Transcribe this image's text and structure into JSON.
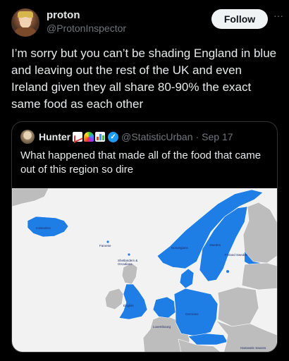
{
  "post": {
    "display_name": "proton",
    "handle": "@ProtonInspector",
    "follow_label": "Follow",
    "more_label": "···",
    "text": "I’m sorry but you can’t be shading England in blue and leaving out the rest of the UK and even Ireland given they all share 80-90% the exact same food as each other"
  },
  "quote": {
    "display_name": "Hunter",
    "badges": [
      "chart-increasing-emoji",
      "rainbow-emoji",
      "bar-chart-emoji"
    ],
    "handle": "@StatisticUrban",
    "separator": "·",
    "date": "Sep 17",
    "text": "What happened that made all of the food that came out of this region so dire",
    "map": {
      "labels": {
        "iceland": "Icelanders",
        "faroe": "Faroese",
        "shetland": "Shetlanders & Orcadians",
        "norway": "Norwegians",
        "sweden": "Swedes",
        "finland": "Finland Swedes",
        "england": "English",
        "germany": "Germans",
        "luxembourg": "Luxembourg",
        "hamburg": "Hanseatic Saxons"
      },
      "colors": {
        "highlight": "#1f7de6",
        "land": "#bdbdbd",
        "sea": "#f2f2f2",
        "border": "#ffffff"
      }
    }
  },
  "theme": {
    "background": "#000000",
    "text": "#e7e9ea",
    "muted": "#71767b",
    "accent": "#1d9bf0"
  }
}
